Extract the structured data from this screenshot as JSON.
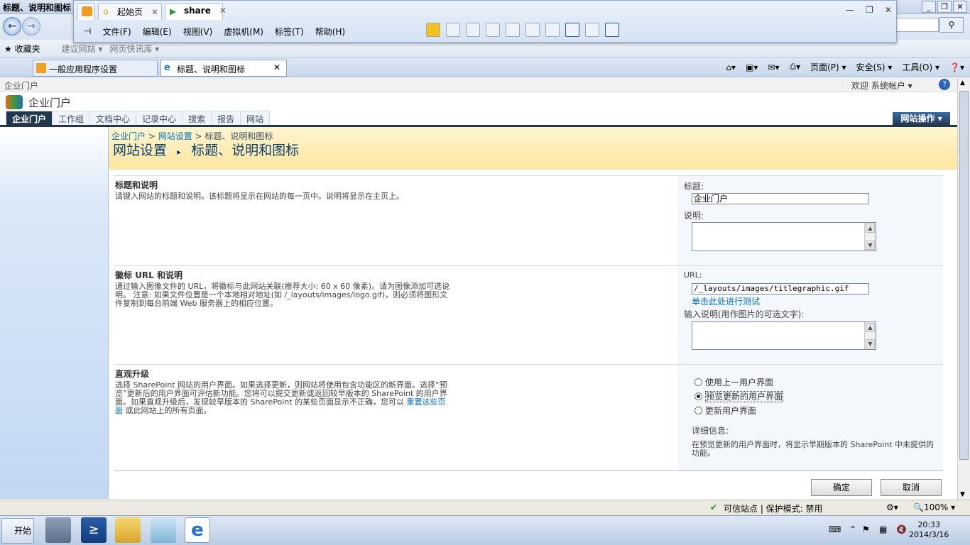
{
  "ie": {
    "window_title": "标题、说明和图标",
    "favorites_label": "收藏夹",
    "fav_items": [
      "建议网站 ▾",
      "网页快讯库 ▾"
    ],
    "tabs": [
      {
        "label": "一般应用程序设置"
      },
      {
        "label": "标题、说明和图标"
      }
    ],
    "cmd_items": [
      "页面(P) ▾",
      "安全(S) ▾",
      "工具(O) ▾"
    ]
  },
  "vm": {
    "tabs": [
      {
        "label": "起始页"
      },
      {
        "label": "share"
      }
    ],
    "menu": [
      "文件(F)",
      "编辑(E)",
      "视图(V)",
      "虚拟机(M)",
      "标签(T)",
      "帮助(H)"
    ]
  },
  "sp": {
    "top_site": "企业门户",
    "welcome": "欢迎 系统帐户 ▾",
    "site_title": "企业门户",
    "nav_tabs": [
      "企业门户",
      "工作组",
      "文档中心",
      "记录中心",
      "搜索",
      "报告",
      "网站"
    ],
    "site_actions": "网站操作 ▾",
    "breadcrumb": {
      "a": "企业门户",
      "b": "网站设置",
      "c": "标题、说明和图标"
    },
    "page_title": {
      "a": "网站设置",
      "b": "标题、说明和图标"
    }
  },
  "sections": {
    "title": {
      "heading": "标题和说明",
      "desc": "请键入网站的标题和说明。该标题将显示在网站的每一页中。说明将显示在主页上。",
      "title_label": "标题:",
      "title_value": "企业门户",
      "desc_label": "说明:"
    },
    "logo": {
      "heading": "徽标 URL 和说明",
      "desc": "通过输入图像文件的 URL，将徽标与此网站关联(推荐大小: 60 x 60 像素)。请为图像添加可选说明。 注意: 如果文件位置是一个本地相对地址(如 /_layouts/images/logo.gif)，则必须将图形文件复制到每台前端 Web 服务器上的相应位置。",
      "url_label": "URL:",
      "url_value": "/_layouts/images/titlegraphic.gif",
      "test_link": "单击此处进行测试",
      "alt_label": "输入说明(用作图片的可选文字):"
    },
    "upgrade": {
      "heading": "直观升级",
      "desc_a": "选择 SharePoint 网站的用户界面。如果选择更新，则网站将使用包含功能区的新界面。选择“预览”更新后的用户界面可评估新功能。您将可以提交更新或返回较早版本的 SharePoint 的用户界面。如果直观升级后，发现较早版本的 SharePoint 的某些页面显示不正确，您可以 ",
      "desc_link": "重置这些页面",
      "desc_b": " 或此网站上的所有页面。",
      "options": [
        "使用上一用户界面",
        "预览更新的用户界面",
        "更新用户界面"
      ],
      "selected": 1,
      "info_label": "详细信息:",
      "info_text": "在预览更新的用户界面时，将显示早期版本的 SharePoint 中未提供的功能。"
    }
  },
  "buttons": {
    "ok": "确定",
    "cancel": "取消"
  },
  "status": {
    "zone": "可信站点 | 保护模式: 禁用",
    "zoom": "100% ▾"
  },
  "taskbar": {
    "start": "开始",
    "time": "20:33",
    "date": "2014/3/16"
  }
}
